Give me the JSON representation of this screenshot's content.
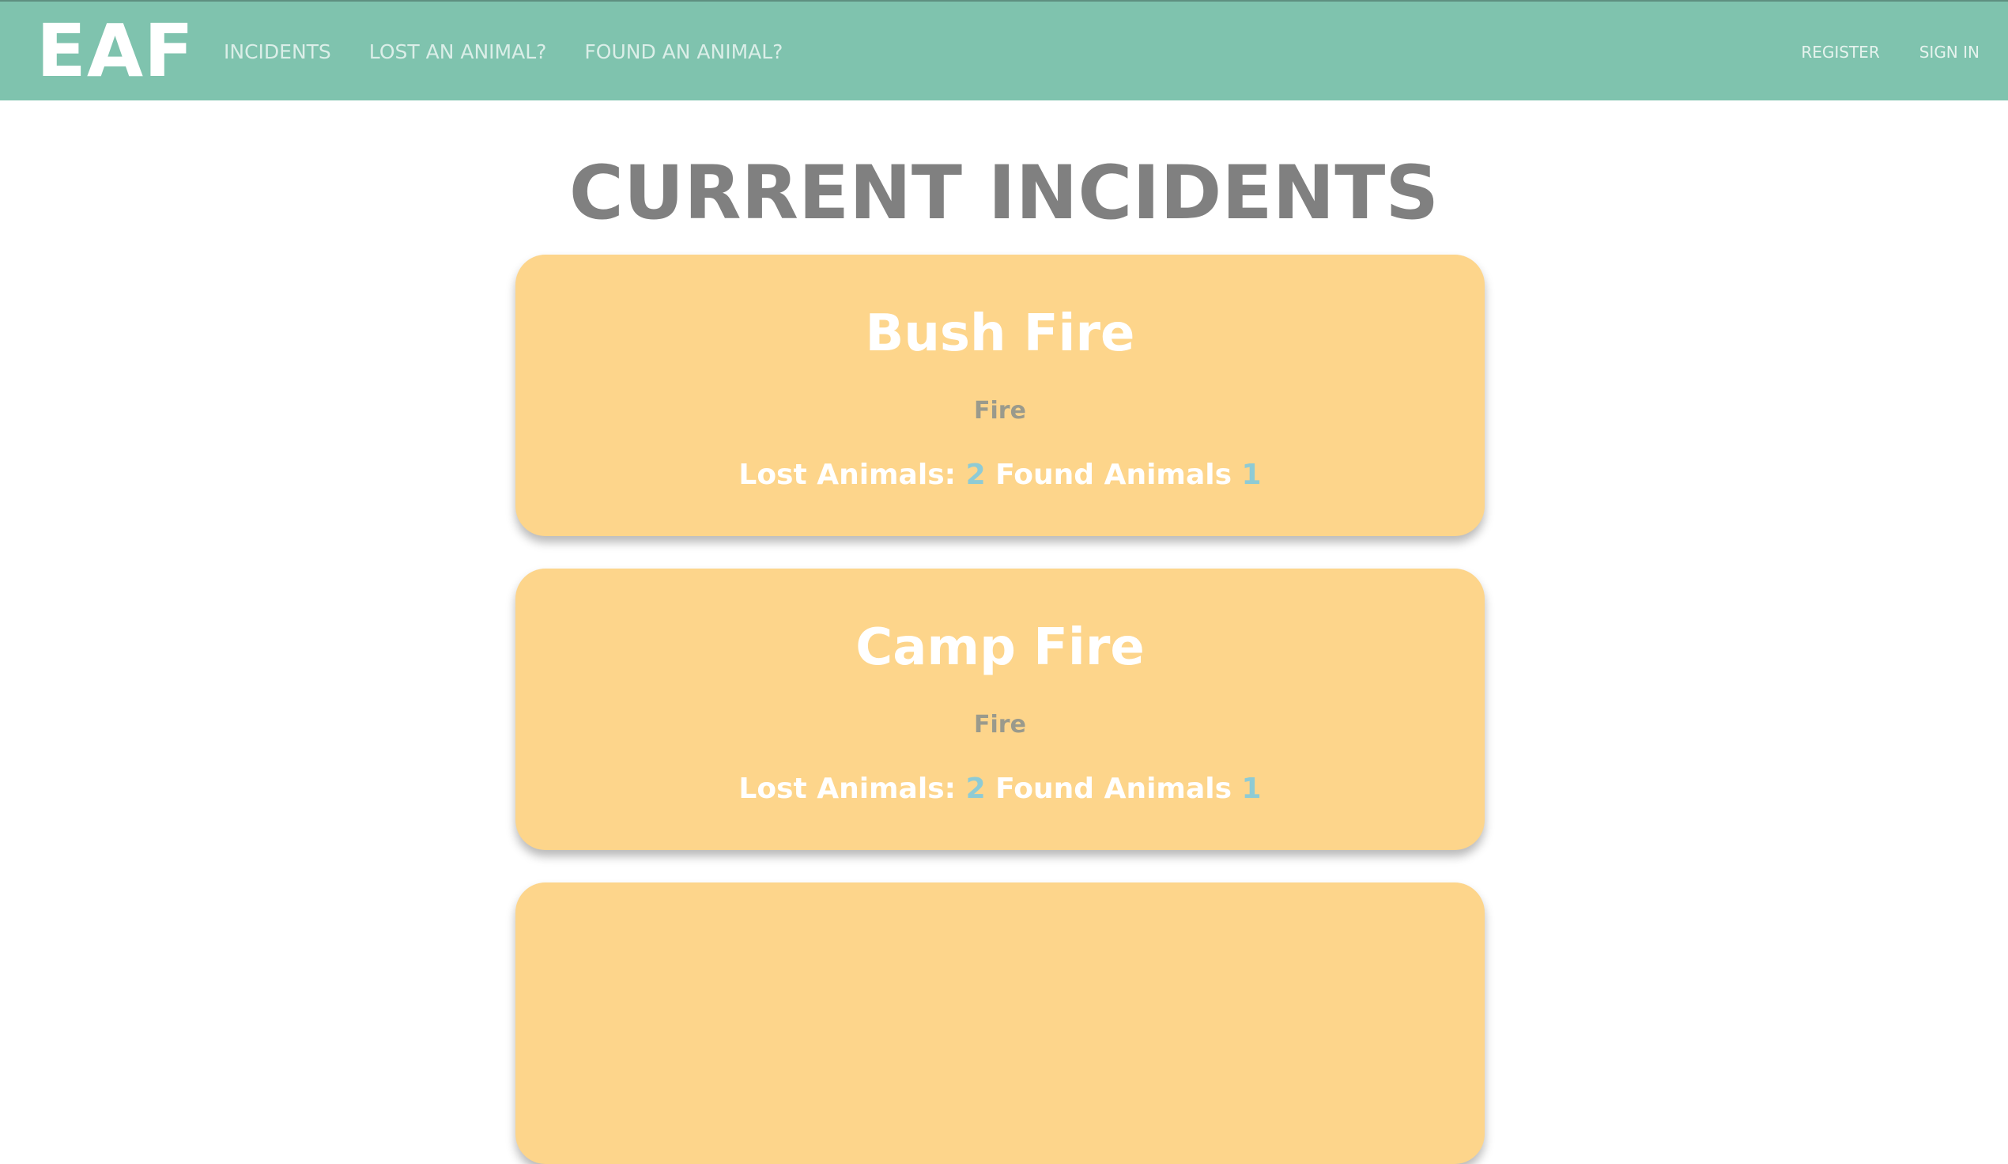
{
  "navbar": {
    "brand": "EAF",
    "links": [
      "INCIDENTS",
      "LOST AN ANIMAL?",
      "FOUND AN ANIMAL?"
    ],
    "register": "REGISTER",
    "sign_in": "SIGN IN"
  },
  "page_title": "CURRENT INCIDENTS",
  "incidents": [
    {
      "title": "Bush Fire",
      "type": "Fire",
      "lost_label": "Lost Animals:",
      "lost_count": "2",
      "found_label": "Found Animals",
      "found_count": "1"
    },
    {
      "title": "Camp Fire",
      "type": "Fire",
      "lost_label": "Lost Animals:",
      "lost_count": "2",
      "found_label": "Found Animals",
      "found_count": "1"
    }
  ],
  "colors": {
    "navbar": "#7fc3ae",
    "card": "#fdd58b",
    "title": "#808080",
    "count": "#8ecbd5"
  }
}
